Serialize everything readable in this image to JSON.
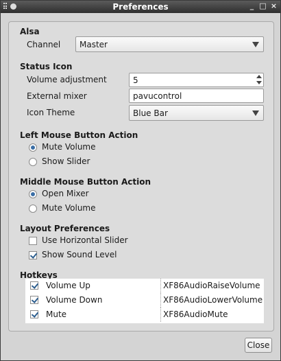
{
  "window": {
    "title": "Preferences"
  },
  "alsa": {
    "heading": "Alsa",
    "channel_label": "Channel",
    "channel_value": "Master"
  },
  "status_icon": {
    "heading": "Status Icon",
    "volume_adjustment_label": "Volume adjustment",
    "volume_adjustment_value": "5",
    "external_mixer_label": "External mixer",
    "external_mixer_value": "pavucontrol",
    "icon_theme_label": "Icon Theme",
    "icon_theme_value": "Blue Bar"
  },
  "left_mouse": {
    "heading": "Left Mouse Button Action",
    "options": [
      {
        "label": "Mute Volume",
        "selected": true
      },
      {
        "label": "Show Slider",
        "selected": false
      }
    ]
  },
  "middle_mouse": {
    "heading": "Middle Mouse Button Action",
    "options": [
      {
        "label": "Open Mixer",
        "selected": true
      },
      {
        "label": "Mute Volume",
        "selected": false
      }
    ]
  },
  "layout_prefs": {
    "heading": "Layout Preferences",
    "options": [
      {
        "label": "Use Horizontal Slider",
        "checked": false
      },
      {
        "label": "Show Sound Level",
        "checked": true
      }
    ]
  },
  "hotkeys": {
    "heading": "Hotkeys",
    "rows": [
      {
        "name": "Volume Up",
        "key": "XF86AudioRaiseVolume",
        "enabled": true
      },
      {
        "name": "Volume Down",
        "key": "XF86AudioLowerVolume",
        "enabled": true
      },
      {
        "name": "Mute",
        "key": "XF86AudioMute",
        "enabled": true
      }
    ]
  },
  "buttons": {
    "close_label": "Close"
  }
}
